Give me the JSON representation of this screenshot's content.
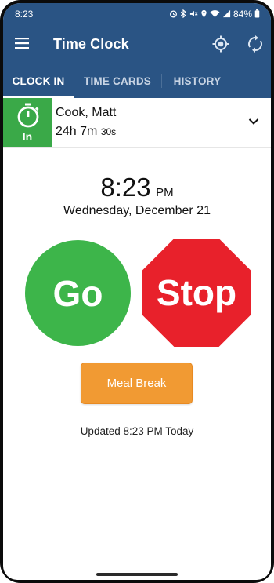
{
  "status_bar": {
    "time": "8:23",
    "battery": "84%",
    "icons": [
      "alarm-icon",
      "bluetooth-icon",
      "mute-icon",
      "location-icon",
      "wifi-icon",
      "signal-icon",
      "battery-icon"
    ]
  },
  "app_bar": {
    "title": "Time Clock",
    "left_icon": "menu-icon",
    "right_icons": [
      "locate-icon",
      "sync-icon"
    ]
  },
  "tabs": [
    {
      "label": "CLOCK IN",
      "active": true
    },
    {
      "label": "TIME CARDS",
      "active": false
    },
    {
      "label": "HISTORY",
      "active": false
    }
  ],
  "employee": {
    "status": "In",
    "name": "Cook, Matt",
    "duration_hours": "24h 7m",
    "duration_seconds": "30s",
    "expand_icon": "chevron-down-icon"
  },
  "clock": {
    "time": "8:23",
    "ampm": "PM",
    "date": "Wednesday, December 21"
  },
  "actions": {
    "go_label": "Go",
    "stop_label": "Stop",
    "meal_break_label": "Meal Break"
  },
  "updated_text": "Updated 8:23 PM Today",
  "colors": {
    "primary": "#2a5484",
    "go_green": "#3db54a",
    "stop_red": "#e8212b",
    "meal_orange": "#f19a33",
    "status_in_green": "#3aa948"
  }
}
